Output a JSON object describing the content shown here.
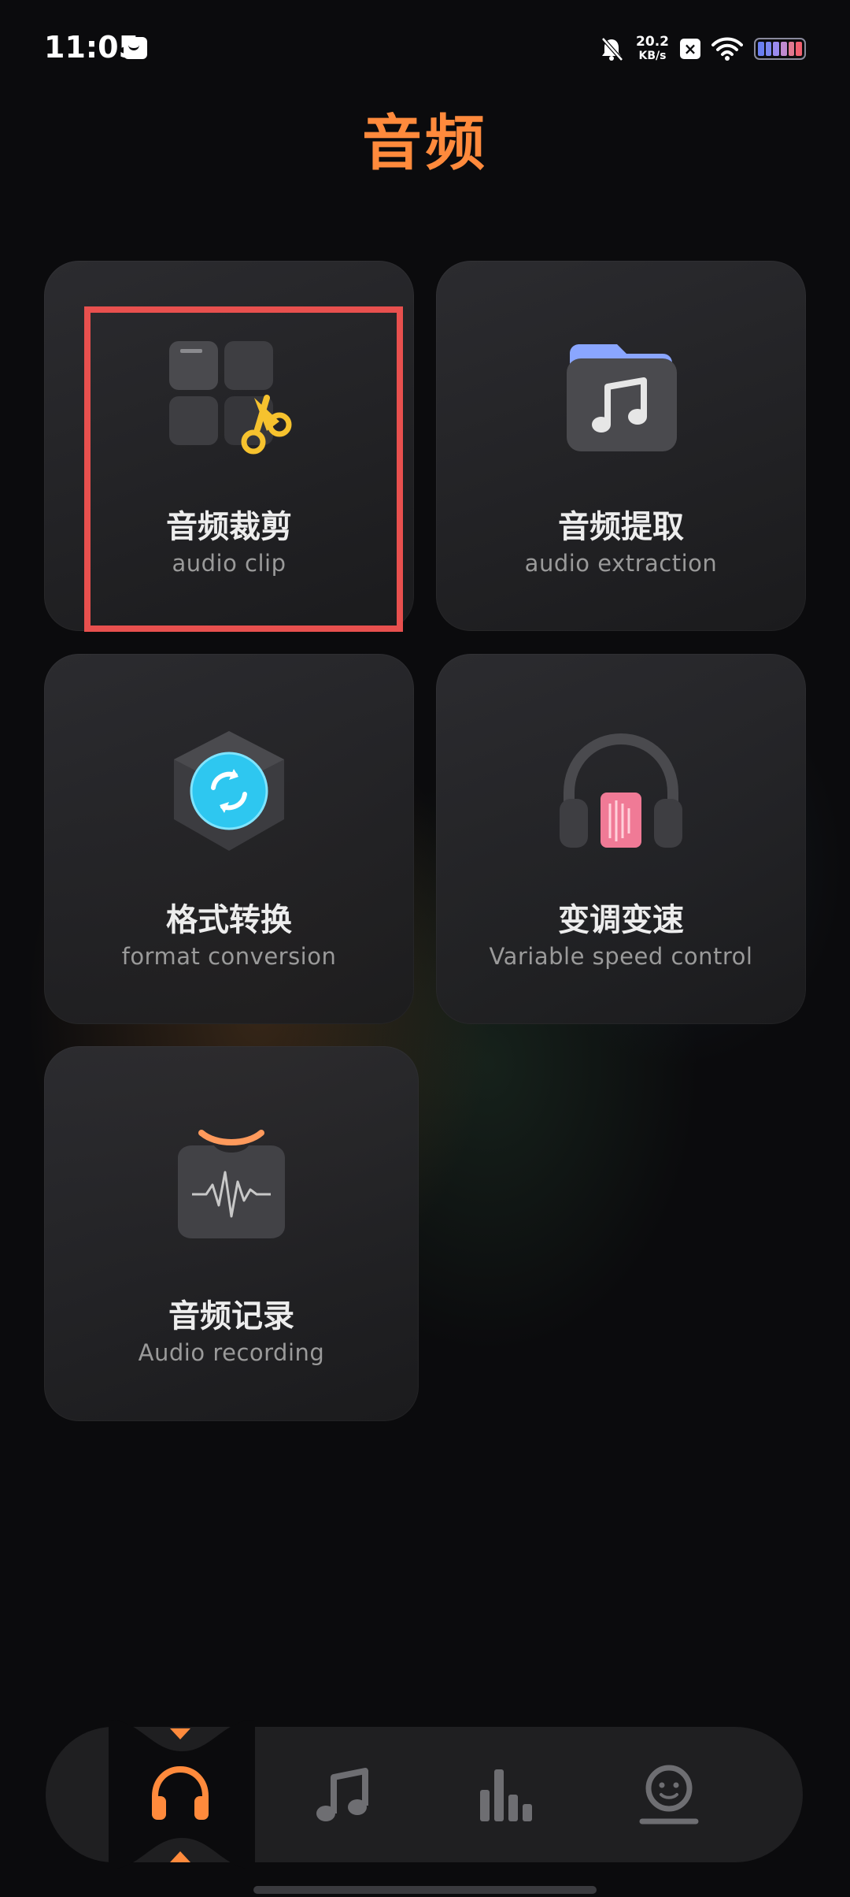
{
  "status_bar": {
    "time": "11:05",
    "speed_value": "20.2",
    "speed_unit": "KB/s",
    "icons": [
      "message-icon",
      "bell-off-icon",
      "close-box-icon",
      "wifi-icon",
      "battery-icon"
    ]
  },
  "page_title": "音频",
  "cards": [
    {
      "title": "音频裁剪",
      "subtitle": "audio clip",
      "icon": "clip-scissors-icon"
    },
    {
      "title": "音频提取",
      "subtitle": "audio extraction",
      "icon": "music-folder-icon"
    },
    {
      "title": "格式转换",
      "subtitle": "format conversion",
      "icon": "format-convert-icon"
    },
    {
      "title": "变调变速",
      "subtitle": "Variable speed control",
      "icon": "headphones-icon"
    },
    {
      "title": "音频记录",
      "subtitle": "Audio recording",
      "icon": "waveform-record-icon"
    }
  ],
  "bottom_nav": {
    "tabs": [
      {
        "icon": "headphones-icon",
        "active": true
      },
      {
        "icon": "music-note-icon",
        "active": false
      },
      {
        "icon": "bar-chart-icon",
        "active": false
      },
      {
        "icon": "profile-icon",
        "active": false
      }
    ]
  },
  "colors": {
    "accent": "#ff8a3c",
    "background": "#0b0b0d",
    "card": "#2a2a2d",
    "highlight": "#e8504e"
  }
}
